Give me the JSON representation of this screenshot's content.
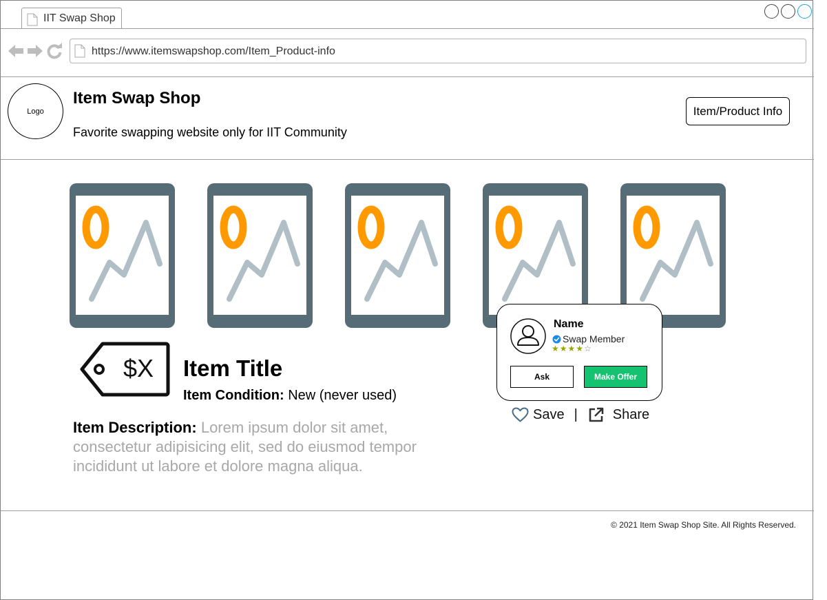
{
  "browser": {
    "tab_title": "IIT Swap Shop",
    "url": "https://www.itemswapshop.com/Item_Product-info"
  },
  "header": {
    "logo_text": "Logo",
    "title": "Item Swap Shop",
    "subtitle": "Favorite swapping website only for IIT Community",
    "page_button_label": "Item/Product Info"
  },
  "gallery": {
    "images": [
      {
        "icon": "image-placeholder-icon"
      },
      {
        "icon": "image-placeholder-icon"
      },
      {
        "icon": "image-placeholder-icon"
      },
      {
        "icon": "image-placeholder-icon"
      },
      {
        "icon": "image-placeholder-icon"
      }
    ]
  },
  "item": {
    "price": "$X",
    "title": "Item Title",
    "condition_label": "Item Condition:",
    "condition_value": "New (never used)",
    "description_label": "Item Description:",
    "description_text": "Lorem ipsum dolor sit amet, consectetur adipisicing elit, sed do eiusmod tempor incididunt ut labore et dolore magna aliqua."
  },
  "seller": {
    "name": "Name",
    "badge": "Swap Member",
    "rating": 4,
    "rating_max": 5,
    "ask_label": "Ask",
    "offer_label": "Make Offer"
  },
  "actions": {
    "save_label": "Save",
    "separator": "|",
    "share_label": "Share"
  },
  "footer": {
    "copyright": "© 2021 Item Swap Shop Site. All Rights Reserved."
  },
  "colors": {
    "accent_green": "#14c270",
    "photo_frame": "#566d78",
    "photo_sun": "#ff9900",
    "photo_mountain": "#b0bec5",
    "verified_blue": "#1e88e5"
  }
}
